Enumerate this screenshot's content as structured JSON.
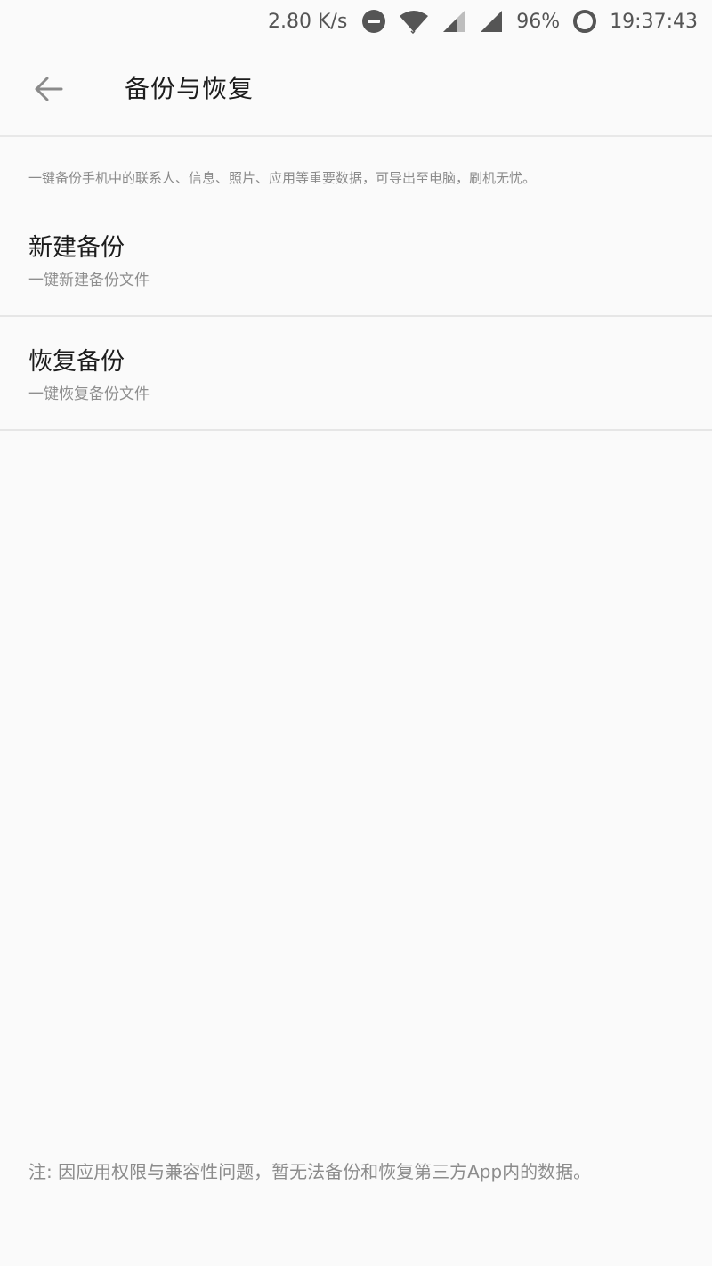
{
  "status_bar": {
    "net_speed": "2.80 K/s",
    "battery": "96%",
    "time": "19:37:43"
  },
  "header": {
    "title": "备份与恢复",
    "back_icon": "arrow-back-icon"
  },
  "main": {
    "description": "一键备份手机中的联系人、信息、照片、应用等重要数据，可导出至电脑，刷机无忧。",
    "items": [
      {
        "title": "新建备份",
        "subtitle": "一键新建备份文件"
      },
      {
        "title": "恢复备份",
        "subtitle": "一键恢复备份文件"
      }
    ]
  },
  "footer": {
    "note": "注: 因应用权限与兼容性问题，暂无法备份和恢复第三方App内的数据。"
  },
  "colors": {
    "background": "#fafafa",
    "divider": "#e6e6e6",
    "primary_text": "#1c1c1c",
    "secondary_text": "#8f8f8f",
    "icon": "#555555"
  }
}
